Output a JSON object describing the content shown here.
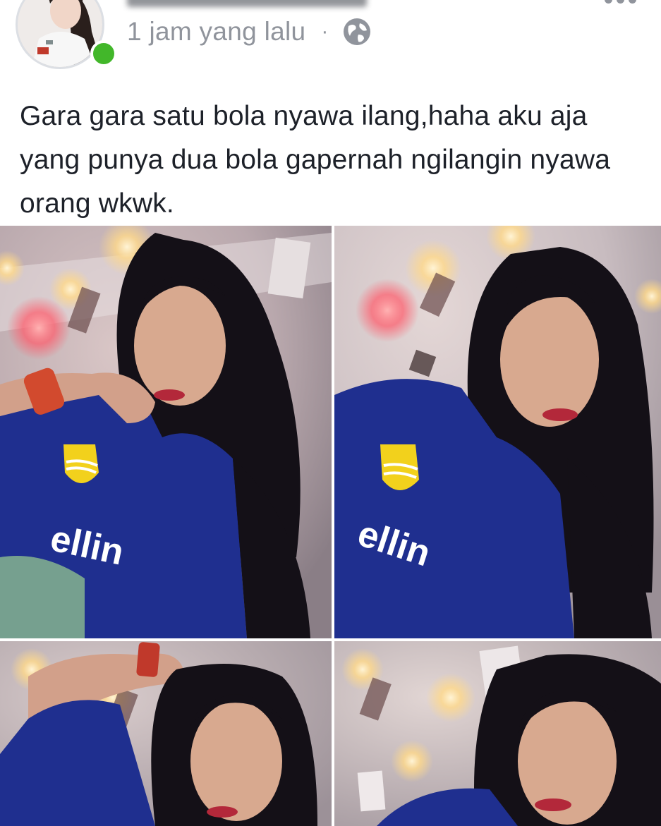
{
  "post": {
    "timestamp": "1 jam yang lalu",
    "separator": "·",
    "privacy_icon": "globe-icon",
    "text": "Gara gara satu bola nyawa ilang,haha aku aja yang punya dua bola gapernah ngilangin nyawa orang wkwk.",
    "online_status_color": "#42b72a"
  },
  "photos": [
    {
      "name": "photo-1"
    },
    {
      "name": "photo-2"
    },
    {
      "name": "photo-3"
    },
    {
      "name": "photo-4"
    }
  ],
  "colors": {
    "text": "#1d2129",
    "meta": "#90949c",
    "jersey": "#1f2f8f"
  }
}
